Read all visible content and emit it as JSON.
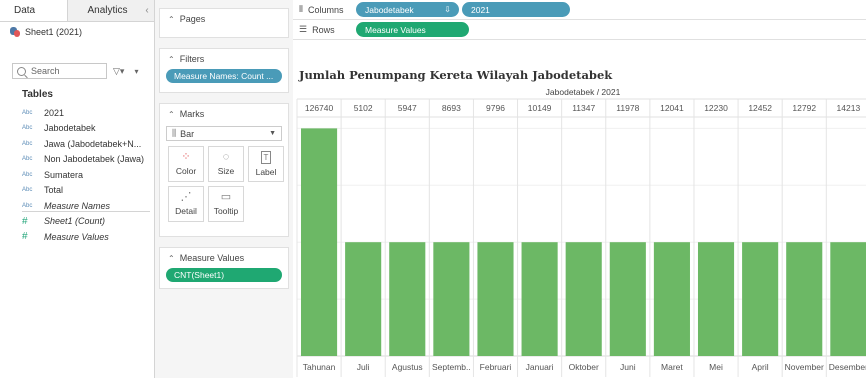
{
  "data_pane": {
    "tabs": [
      "Data",
      "Analytics"
    ],
    "collapse_glyph": "‹",
    "datasource": "Sheet1 (2021)",
    "search_placeholder": "Search",
    "filter_glyph": "▽▾",
    "menu_glyph": "▾",
    "tables_label": "Tables",
    "fields": [
      {
        "type": "Abc",
        "name": "2021",
        "italic": false
      },
      {
        "type": "Abc",
        "name": "Jabodetabek",
        "italic": false
      },
      {
        "type": "Abc",
        "name": "Jawa (Jabodetabek+N...",
        "italic": false
      },
      {
        "type": "Abc",
        "name": "Non Jabodetabek (Jawa)",
        "italic": false
      },
      {
        "type": "Abc",
        "name": "Sumatera",
        "italic": false
      },
      {
        "type": "Abc",
        "name": "Total",
        "italic": false
      },
      {
        "type": "Abc",
        "name": "Measure Names",
        "italic": true
      },
      {
        "type": "#",
        "name": "Sheet1 (Count)",
        "italic": true
      },
      {
        "type": "#",
        "name": "Measure Values",
        "italic": true
      }
    ]
  },
  "cards": {
    "pages": "Pages",
    "filters": "Filters",
    "filter_pill": "Measure Names: Count ...",
    "marks": "Marks",
    "mark_type": "Bar",
    "mark_buttons": [
      {
        "label": "Color",
        "icon": "⁘"
      },
      {
        "label": "Size",
        "icon": "◌"
      },
      {
        "label": "Label",
        "icon": "T"
      },
      {
        "label": "Detail",
        "icon": "⋰"
      },
      {
        "label": "Tooltip",
        "icon": "▭"
      }
    ],
    "measure_values": "Measure Values",
    "measure_pill": "CNT(Sheet1)"
  },
  "shelves": {
    "columns_label": "Columns",
    "columns_pills": [
      "Jabodetabek",
      "2021"
    ],
    "rows_label": "Rows",
    "rows_pill": "Measure Values"
  },
  "chart_data": {
    "type": "bar",
    "title": "Jumlah Penumpang Kereta Wilayah Jabodetabek",
    "header": "Jabodetabek / 2021",
    "categories": [
      "Tahunan",
      "Juli",
      "Agustus",
      "Septemb..",
      "Februari",
      "Januari",
      "Oktober",
      "Juni",
      "Maret",
      "Mei",
      "April",
      "November",
      "Desember"
    ],
    "top_labels": [
      "126740",
      "5102",
      "5947",
      "8693",
      "9796",
      "10149",
      "11347",
      "11978",
      "12041",
      "12230",
      "12452",
      "12792",
      "14213"
    ],
    "values": [
      2,
      1,
      1,
      1,
      1,
      1,
      1,
      1,
      1,
      1,
      1,
      1,
      1
    ],
    "ylim": [
      0,
      2.1
    ],
    "bar_color": "#6cb865",
    "grid": true
  }
}
